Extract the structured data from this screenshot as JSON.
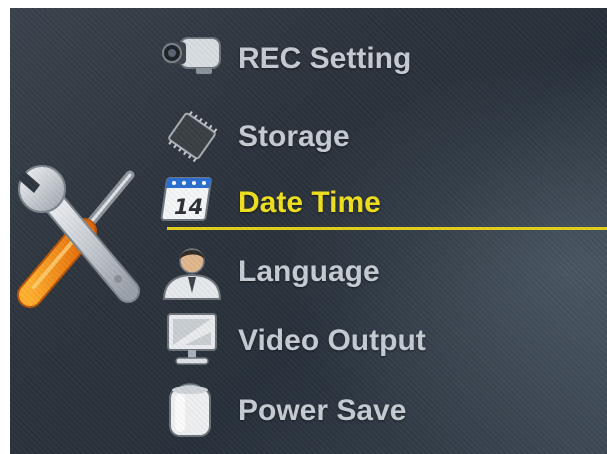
{
  "menu": {
    "items": [
      {
        "label": "REC Setting",
        "icon": "camcorder-icon",
        "active": false
      },
      {
        "label": "Storage",
        "icon": "memory-chip-icon",
        "active": false
      },
      {
        "label": "Date Time",
        "icon": "calendar-icon",
        "active": true,
        "calendar_day": "14"
      },
      {
        "label": "Language",
        "icon": "person-icon",
        "active": false
      },
      {
        "label": "Video Output",
        "icon": "monitor-icon",
        "active": false
      },
      {
        "label": "Power Save",
        "icon": "battery-icon",
        "active": false
      }
    ]
  },
  "category_icon": "wrench-screwdriver-icon",
  "colors": {
    "active_label": "#f0e01d",
    "inactive_label": "#c6ccd3",
    "underline": "#e2cf1c"
  }
}
